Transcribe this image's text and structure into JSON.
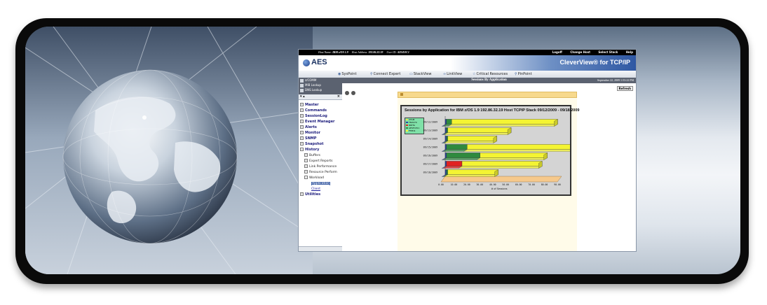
{
  "topbar": {
    "host_name_label": "Host Name:",
    "host_name": "IBM z/OS 1.9",
    "host_address_label": "Host Address:",
    "host_address": "192.86.32.19",
    "user_id_label": "User ID:",
    "user_id": "AESDJC1",
    "links": [
      "Logoff",
      "Change Host",
      "Select Stack",
      "Help"
    ]
  },
  "header": {
    "logo_text": "AES",
    "product": "CleverView® for TCP/IP"
  },
  "toolbar": {
    "items": [
      "SysPoint",
      "Connect Expert",
      "StackView",
      "LinkView",
      "Critical Resources",
      "PinPoint"
    ]
  },
  "sidebar": {
    "quick_links": [
      "z/COMM",
      "MIB Lookup",
      "DNS Lookup"
    ],
    "tree": {
      "top": [
        "Master",
        "Commands",
        "SessionLog",
        "Event Manager",
        "Alerts",
        "Monitor",
        "SNMP",
        "Snapshot",
        "History"
      ],
      "history_children": [
        "Buffers",
        "Expert Reports",
        "Link Performance",
        "Resource Perform",
        "Workload"
      ],
      "workload_children": [
        "Application",
        "Client"
      ],
      "bottom": [
        "Utilities"
      ]
    }
  },
  "page": {
    "title": "Sessions By Application",
    "date": "September 22, 2009 1:53:22 PM",
    "refresh_label": "Refresh"
  },
  "chart_data": {
    "type": "bar",
    "orientation": "horizontal",
    "stacked": true,
    "title": "Sessions by Application for IBM z/OS 1.9 192.86.32.19   Host TCPIP   Stack   09/12/2009 - 09/18/2009",
    "xlabel": "# of Sessions",
    "xlim": [
      0,
      90
    ],
    "xticks": [
      "0.00",
      "10.00",
      "20.00",
      "30.00",
      "40.00",
      "50.00",
      "60.00",
      "70.00",
      "80.00",
      "90.00"
    ],
    "categories": [
      "09/12/2009",
      "09/13/2009",
      "09/14/2009",
      "09/15/2009",
      "09/16/2009",
      "09/17/2009",
      "09/18/2009"
    ],
    "series": [
      {
        "name": "VTAM",
        "color": "#e2e24a",
        "values": [
          0,
          0,
          0,
          0,
          0,
          0,
          0
        ]
      },
      {
        "name": "TN3270",
        "color": "#2442a8",
        "values": [
          1,
          1,
          1,
          1,
          1,
          1,
          1
        ]
      },
      {
        "name": "IRDTA",
        "color": "#e12121",
        "values": [
          0,
          0,
          0,
          0,
          0,
          12,
          0
        ]
      },
      {
        "name": "AESTCP11",
        "color": "#2f8a3e",
        "values": [
          4,
          1,
          1,
          16,
          26,
          0,
          1
        ]
      },
      {
        "name": "FTPD1",
        "color": "#f4f433",
        "values": [
          82,
          49,
          38,
          85,
          52,
          62,
          39
        ]
      }
    ],
    "grid": false,
    "legend": "top-left"
  }
}
